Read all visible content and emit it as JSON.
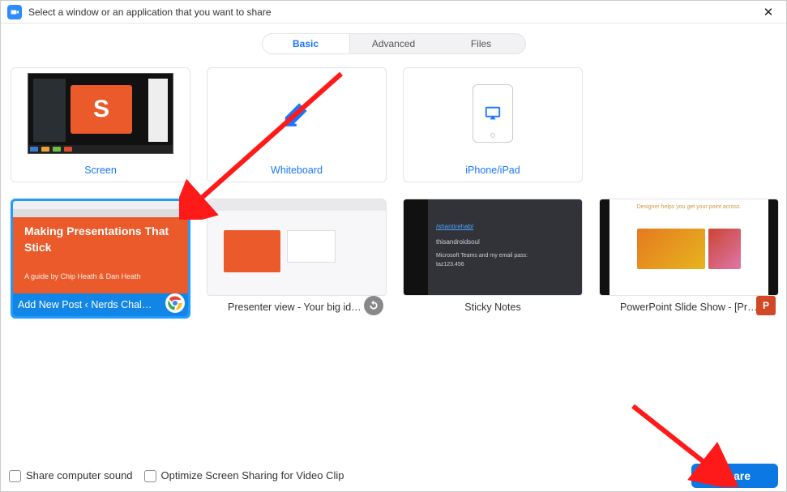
{
  "window": {
    "title": "Select a window or an application that you want to share"
  },
  "tabs": [
    {
      "label": "Basic",
      "active": true
    },
    {
      "label": "Advanced",
      "active": false
    },
    {
      "label": "Files",
      "active": false
    }
  ],
  "row1": {
    "screen": {
      "label": "Screen",
      "glyph": "S"
    },
    "whiteboard": {
      "label": "Whiteboard"
    },
    "ipad": {
      "label": "iPhone/iPad"
    }
  },
  "row2": [
    {
      "id": "chrome",
      "label": "Add New Post ‹ Nerds Chalk — …",
      "selected": true,
      "content_title": "Making Presentations That Stick",
      "content_sub": "A guide by Chip Heath & Dan Heath",
      "badge": "chrome-icon"
    },
    {
      "id": "presenter",
      "label": "Presenter view - Your big idea - G…",
      "selected": false,
      "badge": "sync-icon"
    },
    {
      "id": "sticky",
      "label": "Sticky Notes",
      "selected": false,
      "content_line1": "/shantirehab/",
      "content_line2": "thisandroidsoul",
      "content_line3": "Microsoft Teams and my email pass:",
      "content_line4": "taz123.456"
    },
    {
      "id": "ppt",
      "label": "PowerPoint Slide Show - [Present…",
      "selected": false,
      "content_title": "Designer helps you get your point across.",
      "badge": "powerpoint-icon"
    }
  ],
  "footer": {
    "chk1": "Share computer sound",
    "chk2": "Optimize Screen Sharing for Video Clip",
    "share": "Share"
  }
}
